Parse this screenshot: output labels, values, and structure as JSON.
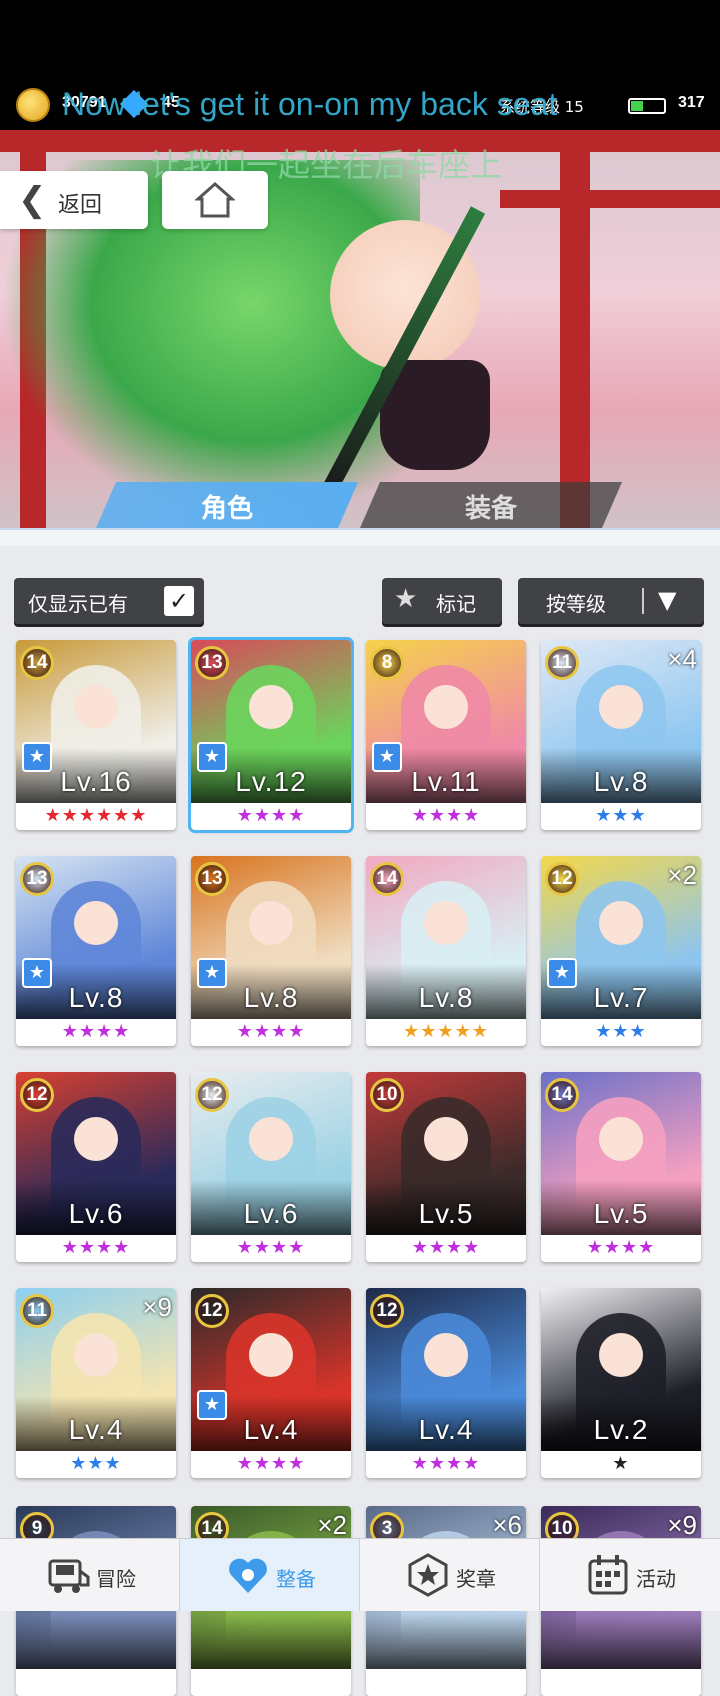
{
  "hud": {
    "coins": "30791",
    "gems": "45",
    "system_level": "系统等级 15",
    "stamina": "317"
  },
  "overlay": {
    "lyrics_en": "Now let's get it on-on my back seat",
    "lyrics_zh": "让我们一起坐在后车座上"
  },
  "nav": {
    "back_label": "返回"
  },
  "tabs": {
    "roles": "角色",
    "equipment": "装备"
  },
  "filters": {
    "owned_only": "仅显示已有",
    "owned_checked": true,
    "mark": "标记",
    "sort": "按等级"
  },
  "cards": [
    {
      "badge": "14",
      "level": "Lv.16",
      "stars": "★★★★★★",
      "star_color": "#e8262e",
      "fav": true,
      "dup": "",
      "palette": [
        "#f0eee8",
        "#c89a3a"
      ],
      "selected": false
    },
    {
      "badge": "13",
      "level": "Lv.12",
      "stars": "★★★★",
      "star_color": "#c02ee0",
      "fav": true,
      "dup": "",
      "palette": [
        "#6bd45c",
        "#d94a5a"
      ],
      "selected": true
    },
    {
      "badge": "8",
      "level": "Lv.11",
      "stars": "★★★★",
      "star_color": "#c02ee0",
      "fav": true,
      "dup": "",
      "palette": [
        "#f08aa6",
        "#f5d24a"
      ],
      "selected": false
    },
    {
      "badge": "11",
      "level": "Lv.8",
      "stars": "★★★",
      "star_color": "#2d7ee8",
      "fav": false,
      "dup": "×4",
      "palette": [
        "#8fc7f0",
        "#dfe8f6"
      ],
      "selected": false
    },
    {
      "badge": "13",
      "level": "Lv.8",
      "stars": "★★★★",
      "star_color": "#c02ee0",
      "fav": true,
      "dup": "",
      "palette": [
        "#5f86d8",
        "#d6e4f2"
      ],
      "selected": false
    },
    {
      "badge": "13",
      "level": "Lv.8",
      "stars": "★★★★",
      "star_color": "#c02ee0",
      "fav": true,
      "dup": "",
      "palette": [
        "#f0dcc0",
        "#d8741e"
      ],
      "selected": false
    },
    {
      "badge": "14",
      "level": "Lv.8",
      "stars": "★★★★★",
      "star_color": "#f0a020",
      "fav": false,
      "dup": "",
      "palette": [
        "#d8eef3",
        "#f2a8c0"
      ],
      "selected": false
    },
    {
      "badge": "12",
      "level": "Lv.7",
      "stars": "★★★",
      "star_color": "#2d7ee8",
      "fav": true,
      "dup": "×2",
      "palette": [
        "#8ec5ee",
        "#f4d84a"
      ],
      "selected": false
    },
    {
      "badge": "12",
      "level": "Lv.6",
      "stars": "★★★★",
      "star_color": "#c02ee0",
      "fav": false,
      "dup": "",
      "palette": [
        "#2a2a5a",
        "#d84030"
      ],
      "selected": false
    },
    {
      "badge": "12",
      "level": "Lv.6",
      "stars": "★★★★",
      "star_color": "#c02ee0",
      "fav": false,
      "dup": "",
      "palette": [
        "#9cd2e4",
        "#e8ecef"
      ],
      "selected": false
    },
    {
      "badge": "10",
      "level": "Lv.5",
      "stars": "★★★★",
      "star_color": "#c02ee0",
      "fav": false,
      "dup": "",
      "palette": [
        "#3a2a2a",
        "#c23a3a"
      ],
      "selected": false
    },
    {
      "badge": "14",
      "level": "Lv.5",
      "stars": "★★★★",
      "star_color": "#c02ee0",
      "fav": false,
      "dup": "",
      "palette": [
        "#f5a0c0",
        "#6a70c8"
      ],
      "selected": false
    },
    {
      "badge": "11",
      "level": "Lv.4",
      "stars": "★★★",
      "star_color": "#2d7ee8",
      "fav": false,
      "dup": "×9",
      "palette": [
        "#f4e4b0",
        "#8dcff0"
      ],
      "selected": false
    },
    {
      "badge": "12",
      "level": "Lv.4",
      "stars": "★★★★",
      "star_color": "#c02ee0",
      "fav": true,
      "dup": "",
      "palette": [
        "#d8342a",
        "#2a2a2a"
      ],
      "selected": false
    },
    {
      "badge": "12",
      "level": "Lv.4",
      "stars": "★★★★",
      "star_color": "#c02ee0",
      "fav": false,
      "dup": "",
      "palette": [
        "#4a8ad8",
        "#1e2a4a"
      ],
      "selected": false
    },
    {
      "badge": "",
      "level": "Lv.2",
      "stars": "★",
      "star_color": "#222222",
      "fav": false,
      "dup": "",
      "palette": [
        "#1e1e28",
        "#f0f0f4"
      ],
      "selected": false
    },
    {
      "badge": "9",
      "level": "",
      "stars": "",
      "star_color": "#c02ee0",
      "fav": false,
      "dup": "",
      "palette": [
        "#7a8cb8",
        "#2a3a5a"
      ],
      "selected": false
    },
    {
      "badge": "14",
      "level": "",
      "stars": "",
      "star_color": "#c02ee0",
      "fav": false,
      "dup": "×2",
      "palette": [
        "#8ab84a",
        "#3a5a2a"
      ],
      "selected": false
    },
    {
      "badge": "3",
      "level": "",
      "stars": "",
      "star_color": "#c02ee0",
      "fav": false,
      "dup": "×6",
      "palette": [
        "#b8d0e8",
        "#5a6a8a"
      ],
      "selected": false
    },
    {
      "badge": "10",
      "level": "",
      "stars": "",
      "star_color": "#c02ee0",
      "fav": false,
      "dup": "×9",
      "palette": [
        "#9a7ab8",
        "#3a2a5a"
      ],
      "selected": false
    }
  ],
  "bottom_nav": [
    {
      "label": "冒险",
      "icon": "truck-icon",
      "active": false
    },
    {
      "label": "整备",
      "icon": "heart-gear-icon",
      "active": true
    },
    {
      "label": "奖章",
      "icon": "medal-star-icon",
      "active": false
    },
    {
      "label": "活动",
      "icon": "calendar-icon",
      "active": false
    }
  ],
  "colors": {
    "accent": "#4fb6f3",
    "badge_ring": "#e8c541"
  }
}
